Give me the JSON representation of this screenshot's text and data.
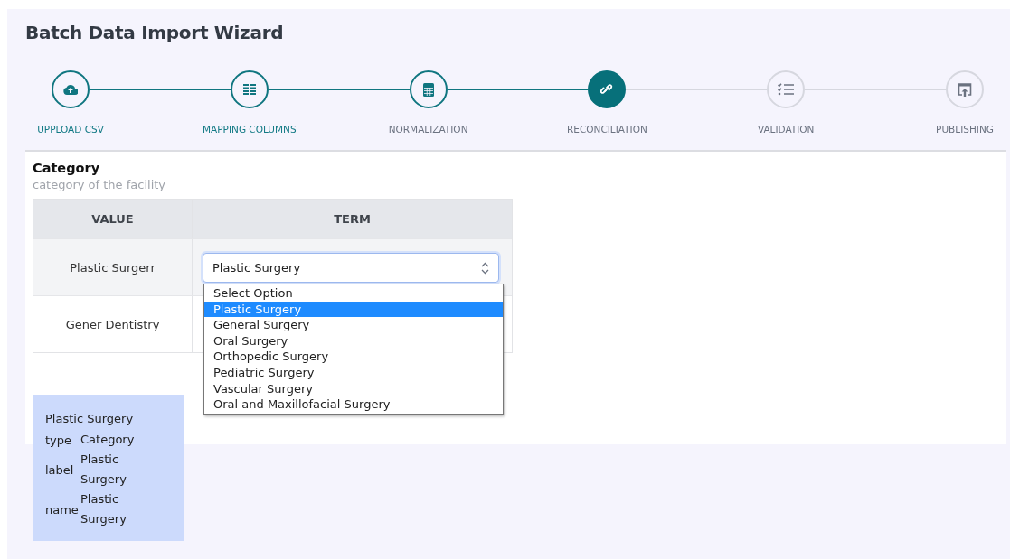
{
  "title": "Batch Data Import Wizard",
  "steps": [
    {
      "label": "UPPLOAD CSV",
      "completed": true,
      "visited": true,
      "selected": false
    },
    {
      "label": "MAPPING COLUMNS",
      "completed": true,
      "visited": true,
      "selected": false
    },
    {
      "label": "NORMALIZATION",
      "completed": true,
      "visited": false,
      "selected": false
    },
    {
      "label": "RECONCILIATION",
      "completed": false,
      "visited": false,
      "selected": true
    },
    {
      "label": "VALIDATION",
      "completed": false,
      "visited": false,
      "selected": false
    },
    {
      "label": "PUBLISHING",
      "completed": false,
      "visited": false,
      "selected": false
    }
  ],
  "field": {
    "name": "Category",
    "description": "category of the facility"
  },
  "table": {
    "columns": [
      "VALUE",
      "TERM"
    ],
    "rows": [
      {
        "value": "Plastic Surgerr",
        "term": "Plastic Surgery"
      },
      {
        "value": "Gener Dentistry"
      }
    ]
  },
  "dropdown": {
    "options": [
      {
        "label": "Select Option",
        "selected": false
      },
      {
        "label": "Plastic Surgery",
        "selected": true
      },
      {
        "label": "General Surgery",
        "selected": false
      },
      {
        "label": "Oral Surgery",
        "selected": false
      },
      {
        "label": "Orthopedic Surgery",
        "selected": false
      },
      {
        "label": "Pediatric Surgery",
        "selected": false
      },
      {
        "label": "Vascular Surgery",
        "selected": false
      },
      {
        "label": "Oral and Maxillofacial Surgery",
        "selected": false
      }
    ]
  },
  "info": {
    "heading": "Plastic Surgery",
    "props": [
      {
        "key": "type",
        "value": "Category"
      },
      {
        "key": "label",
        "value": "Plastic Surgery"
      },
      {
        "key": "name",
        "value": "Plastic Surgery"
      }
    ]
  }
}
